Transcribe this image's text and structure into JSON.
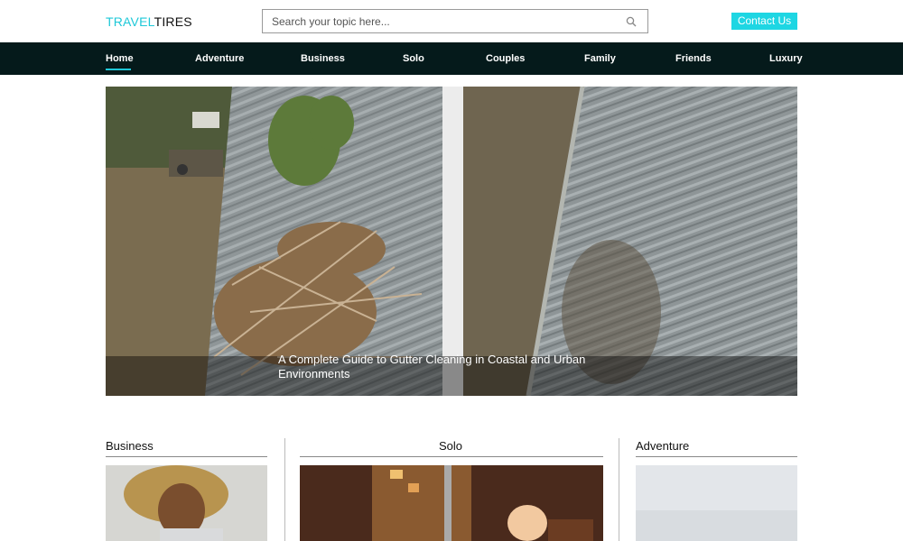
{
  "header": {
    "logo_part1": "TRAVEL",
    "logo_part2": "TIRES",
    "search_placeholder": "Search your topic here...",
    "search_icon": "search-icon",
    "contact_label": "Contact Us",
    "accent_color": "#1ed6e3"
  },
  "nav": {
    "items": [
      {
        "label": "Home",
        "active": true
      },
      {
        "label": "Adventure"
      },
      {
        "label": "Business"
      },
      {
        "label": "Solo"
      },
      {
        "label": "Couples"
      },
      {
        "label": "Family"
      },
      {
        "label": "Friends"
      },
      {
        "label": "Luxury"
      }
    ],
    "background": "#051a1b"
  },
  "hero": {
    "caption": "A Complete Guide to Gutter Cleaning in Coastal and Urban Environments"
  },
  "sections": [
    {
      "title": "Business"
    },
    {
      "title": "Solo"
    },
    {
      "title": "Adventure"
    }
  ]
}
